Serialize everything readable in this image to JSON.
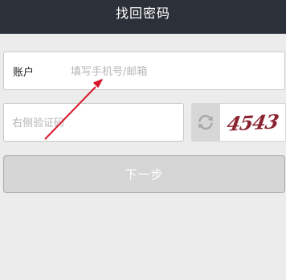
{
  "header": {
    "title": "找回密码"
  },
  "account": {
    "label": "账户",
    "placeholder": "填写手机号/邮箱",
    "value": ""
  },
  "captcha": {
    "placeholder": "右侧验证码",
    "value": "",
    "image_text": "4543"
  },
  "next_button": {
    "label": "下一步"
  },
  "colors": {
    "header_bg": "#2c3139",
    "arrow": "#d8182a",
    "captcha_text": "#8b2330"
  },
  "icons": {
    "refresh": "refresh-icon"
  }
}
